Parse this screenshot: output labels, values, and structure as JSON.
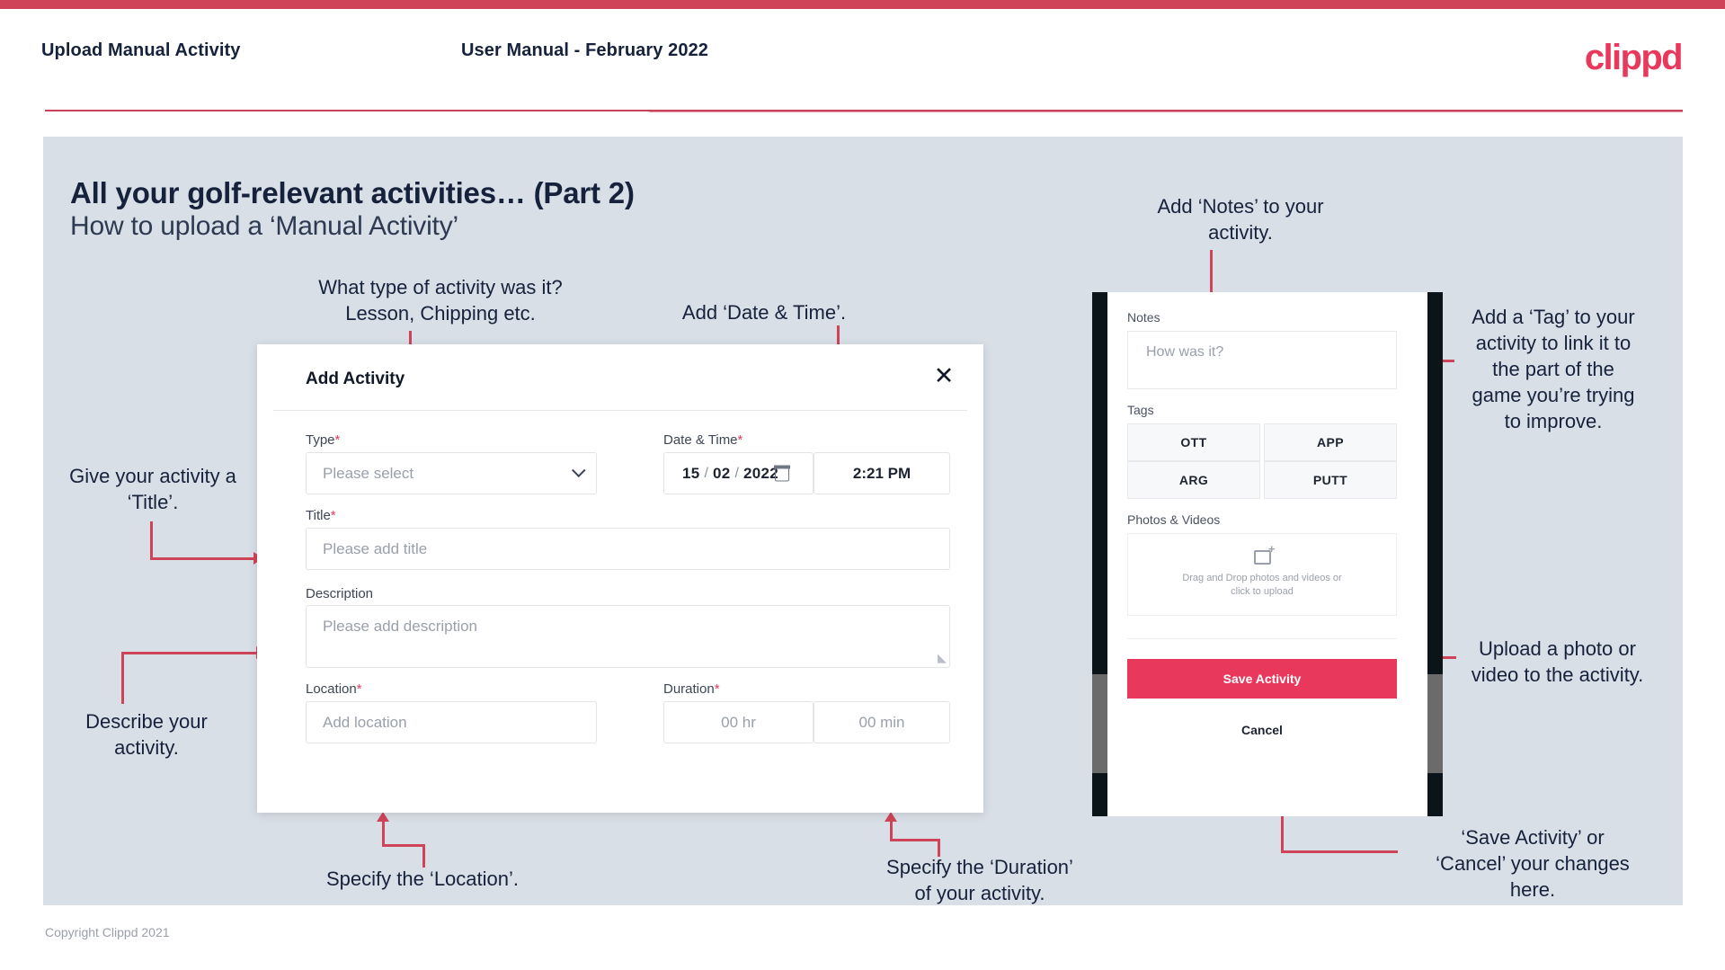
{
  "header": {
    "title": "Upload Manual Activity",
    "subtitle": "User Manual - February 2022",
    "logo": "clippd"
  },
  "slide": {
    "heading": "All your golf-relevant activities… (Part 2)",
    "subheading": "How to upload a ‘Manual Activity’"
  },
  "annotations": {
    "type": "What type of activity was it?\nLesson, Chipping etc.",
    "datetime": "Add ‘Date & Time’.",
    "title": "Give your activity a\n‘Title’.",
    "description": "Describe your\nactivity.",
    "location": "Specify the ‘Location’.",
    "duration": "Specify the ‘Duration’\nof your activity.",
    "notes": "Add ‘Notes’ to your\nactivity.",
    "tags": "Add a ‘Tag’ to your\nactivity to link it to\nthe part of the\ngame you’re trying\nto improve.",
    "photos": "Upload a photo or\nvideo to the activity.",
    "save": "‘Save Activity’ or\n‘Cancel’ your changes\nhere."
  },
  "dialog": {
    "title": "Add Activity",
    "close_icon": "close-icon",
    "fields": {
      "type": {
        "label": "Type",
        "required": "*",
        "placeholder": "Please select"
      },
      "datetime": {
        "label": "Date & Time",
        "required": "*",
        "day": "15",
        "month": "02",
        "year": "2022",
        "sep": "/",
        "time": "2:21 PM"
      },
      "title": {
        "label": "Title",
        "required": "*",
        "placeholder": "Please add title"
      },
      "description": {
        "label": "Description",
        "placeholder": "Please add description"
      },
      "location": {
        "label": "Location",
        "required": "*",
        "placeholder": "Add location"
      },
      "duration": {
        "label": "Duration",
        "required": "*",
        "hours": "00 hr",
        "minutes": "00 min"
      }
    }
  },
  "phone": {
    "notes": {
      "label": "Notes",
      "placeholder": "How was it?"
    },
    "tags": {
      "label": "Tags",
      "items": [
        "OTT",
        "APP",
        "ARG",
        "PUTT"
      ]
    },
    "photos": {
      "label": "Photos & Videos",
      "dropzone_line1": "Drag and Drop photos and videos or",
      "dropzone_line2": "click to upload"
    },
    "save_label": "Save Activity",
    "cancel_label": "Cancel"
  },
  "footer": {
    "copyright": "Copyright Clippd 2021"
  },
  "colors": {
    "brand_pink": "#e8395c",
    "accent_line": "#cf4459",
    "slide_bg": "#d9dfe7",
    "text_dark": "#16223c"
  }
}
